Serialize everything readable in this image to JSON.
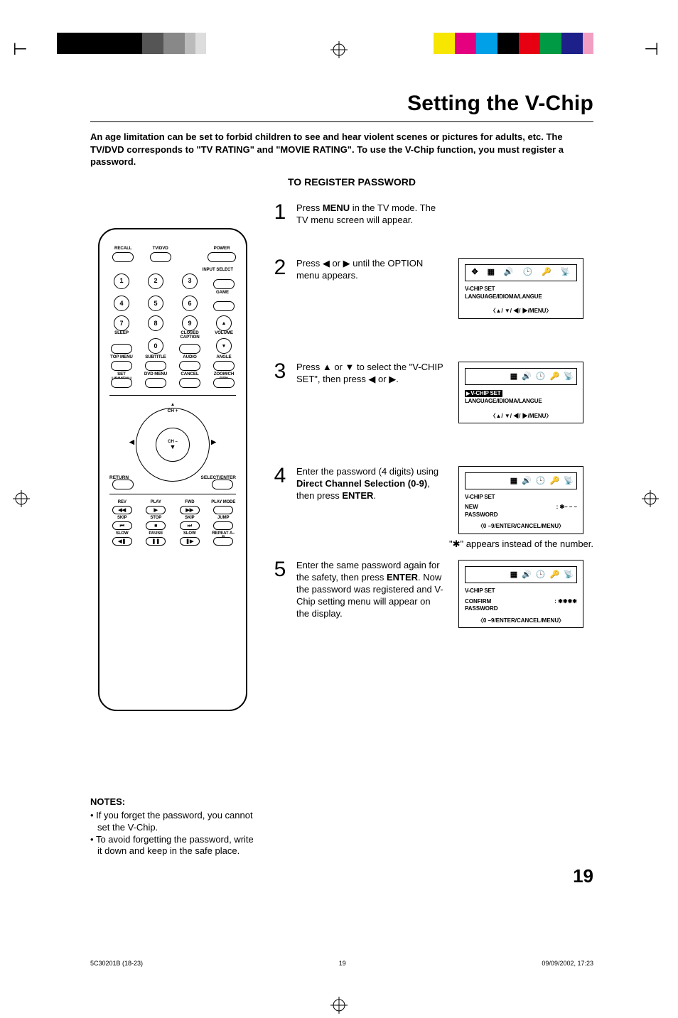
{
  "title": "Setting the V-Chip",
  "intro": "An age limitation can be set to forbid children to see and hear violent scenes or pictures for adults, etc. The TV/DVD corresponds to \"TV RATING\" and \"MOVIE RATING\". To use the V-Chip function, you must register a password.",
  "subheader": "TO REGISTER PASSWORD",
  "remote": {
    "recall": "RECALL",
    "tvdvd": "TV/DVD",
    "power": "POWER",
    "input_select": "INPUT SELECT",
    "game": "GAME",
    "sleep": "SLEEP",
    "closed_caption": "CLOSED\nCAPTION",
    "volume": "VOLUME",
    "top_menu": "TOP MENU",
    "subtitle": "SUBTITLE",
    "audio": "AUDIO",
    "angle": "ANGLE",
    "setup_menu": "SET UP/MENU",
    "dvd_menu": "DVD MENU",
    "cancel": "CANCEL",
    "zoom": "ZOOM/CH RTN",
    "ch_plus": "CH +",
    "ch_minus": "CH –",
    "return": "RETURN",
    "select_enter": "SELECT/ENTER",
    "rev": "REV",
    "play": "PLAY",
    "fwd": "FWD",
    "play_mode": "PLAY MODE",
    "skip_prev": "SKIP",
    "stop": "STOP",
    "skip_next": "SKIP",
    "jump": "JUMP",
    "slow_rev": "SLOW",
    "pause": "PAUSE",
    "slow_fwd": "SLOW",
    "repeat": "REPEAT A–B",
    "digits": [
      "1",
      "2",
      "3",
      "4",
      "5",
      "6",
      "7",
      "8",
      "9",
      "0"
    ]
  },
  "steps": {
    "s1": {
      "pre": "Press ",
      "bold": "MENU",
      "post": " in the TV mode. The TV menu screen will appear."
    },
    "s2": {
      "text": "Press ◀ or ▶ until the OPTION menu appears.",
      "screen": {
        "line1": "V-CHIP SET",
        "line2": "LANGUAGE/IDIOMA/LANGUE",
        "hint": "〈▲/ ▼/ ◀/ ▶/MENU〉"
      }
    },
    "s3": {
      "text": "Press ▲ or ▼ to select the \"V-CHIP SET\", then press ◀ or ▶.",
      "screen": {
        "line1": "V-CHIP SET",
        "line2": "LANGUAGE/IDIOMA/LANGUE",
        "hint": "〈▲/ ▼/ ◀/ ▶/MENU〉"
      }
    },
    "s4": {
      "pre": "Enter the password (4 digits) using ",
      "bold1": "Direct Channel Selection (0-9)",
      "mid": ", then press ",
      "bold2": "ENTER",
      "post": ".",
      "screen": {
        "title": "V-CHIP SET",
        "label": "NEW\nPASSWORD",
        "value": ": ✱– – –",
        "hint": "〈0 –9/ENTER/CANCEL/MENU〉"
      },
      "caption": "\"✱\" appears instead of the number."
    },
    "s5": {
      "pre": "Enter the same password again for the safety, then press ",
      "bold": "ENTER",
      "post": ". Now the password was registered and V-Chip setting menu will appear on the display.",
      "screen": {
        "title": "V-CHIP SET",
        "label": "CONFIRM\nPASSWORD",
        "value": ": ✱✱✱✱",
        "hint": "〈0 –9/ENTER/CANCEL/MENU〉"
      }
    }
  },
  "notes": {
    "head": "NOTES:",
    "n1": "If you forget the password, you cannot set the V-Chip.",
    "n2": "To avoid forgetting the password, write it down and keep in the safe place."
  },
  "page_number": "19",
  "footer": {
    "left": "5C30201B (18-23)",
    "center": "19",
    "right": "09/09/2002, 17:23"
  }
}
